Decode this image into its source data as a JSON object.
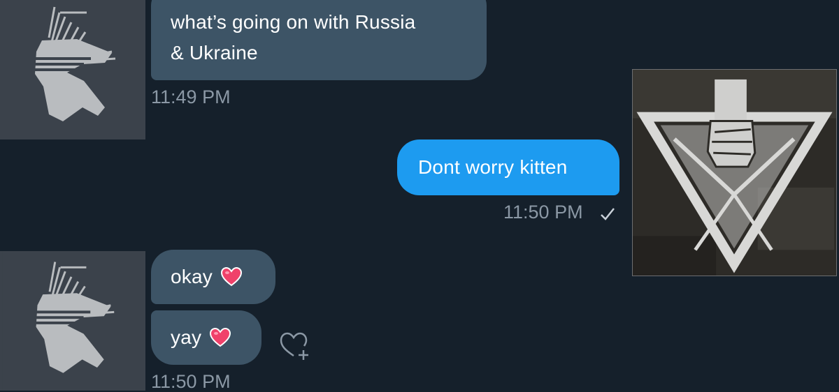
{
  "conversation": {
    "messages": [
      {
        "sender": "them",
        "text": "what’s going on with Russia",
        "text_line2": "& Ukraine"
      },
      {
        "sender": "me",
        "text": "Dont worry kitten"
      },
      {
        "sender": "them",
        "text": "okay",
        "emoji": "heart"
      },
      {
        "sender": "them",
        "text": "yay",
        "emoji": "heart"
      }
    ],
    "timestamps": [
      "11:49 PM",
      "11:50 PM",
      "11:50 PM"
    ]
  },
  "icons": {
    "read_receipt": "checkmark-icon",
    "react": "add-reaction-icon",
    "avatar_them": "eagle-avatar",
    "avatar_me": "triangle-fist-avatar",
    "reaction_emoji": "heart-emoji"
  },
  "colors": {
    "background": "#15202b",
    "incoming_bubble": "#3d5466",
    "outgoing_bubble": "#1d9bf0",
    "timestamp": "#8b98a5",
    "heart": "#f0416a"
  }
}
